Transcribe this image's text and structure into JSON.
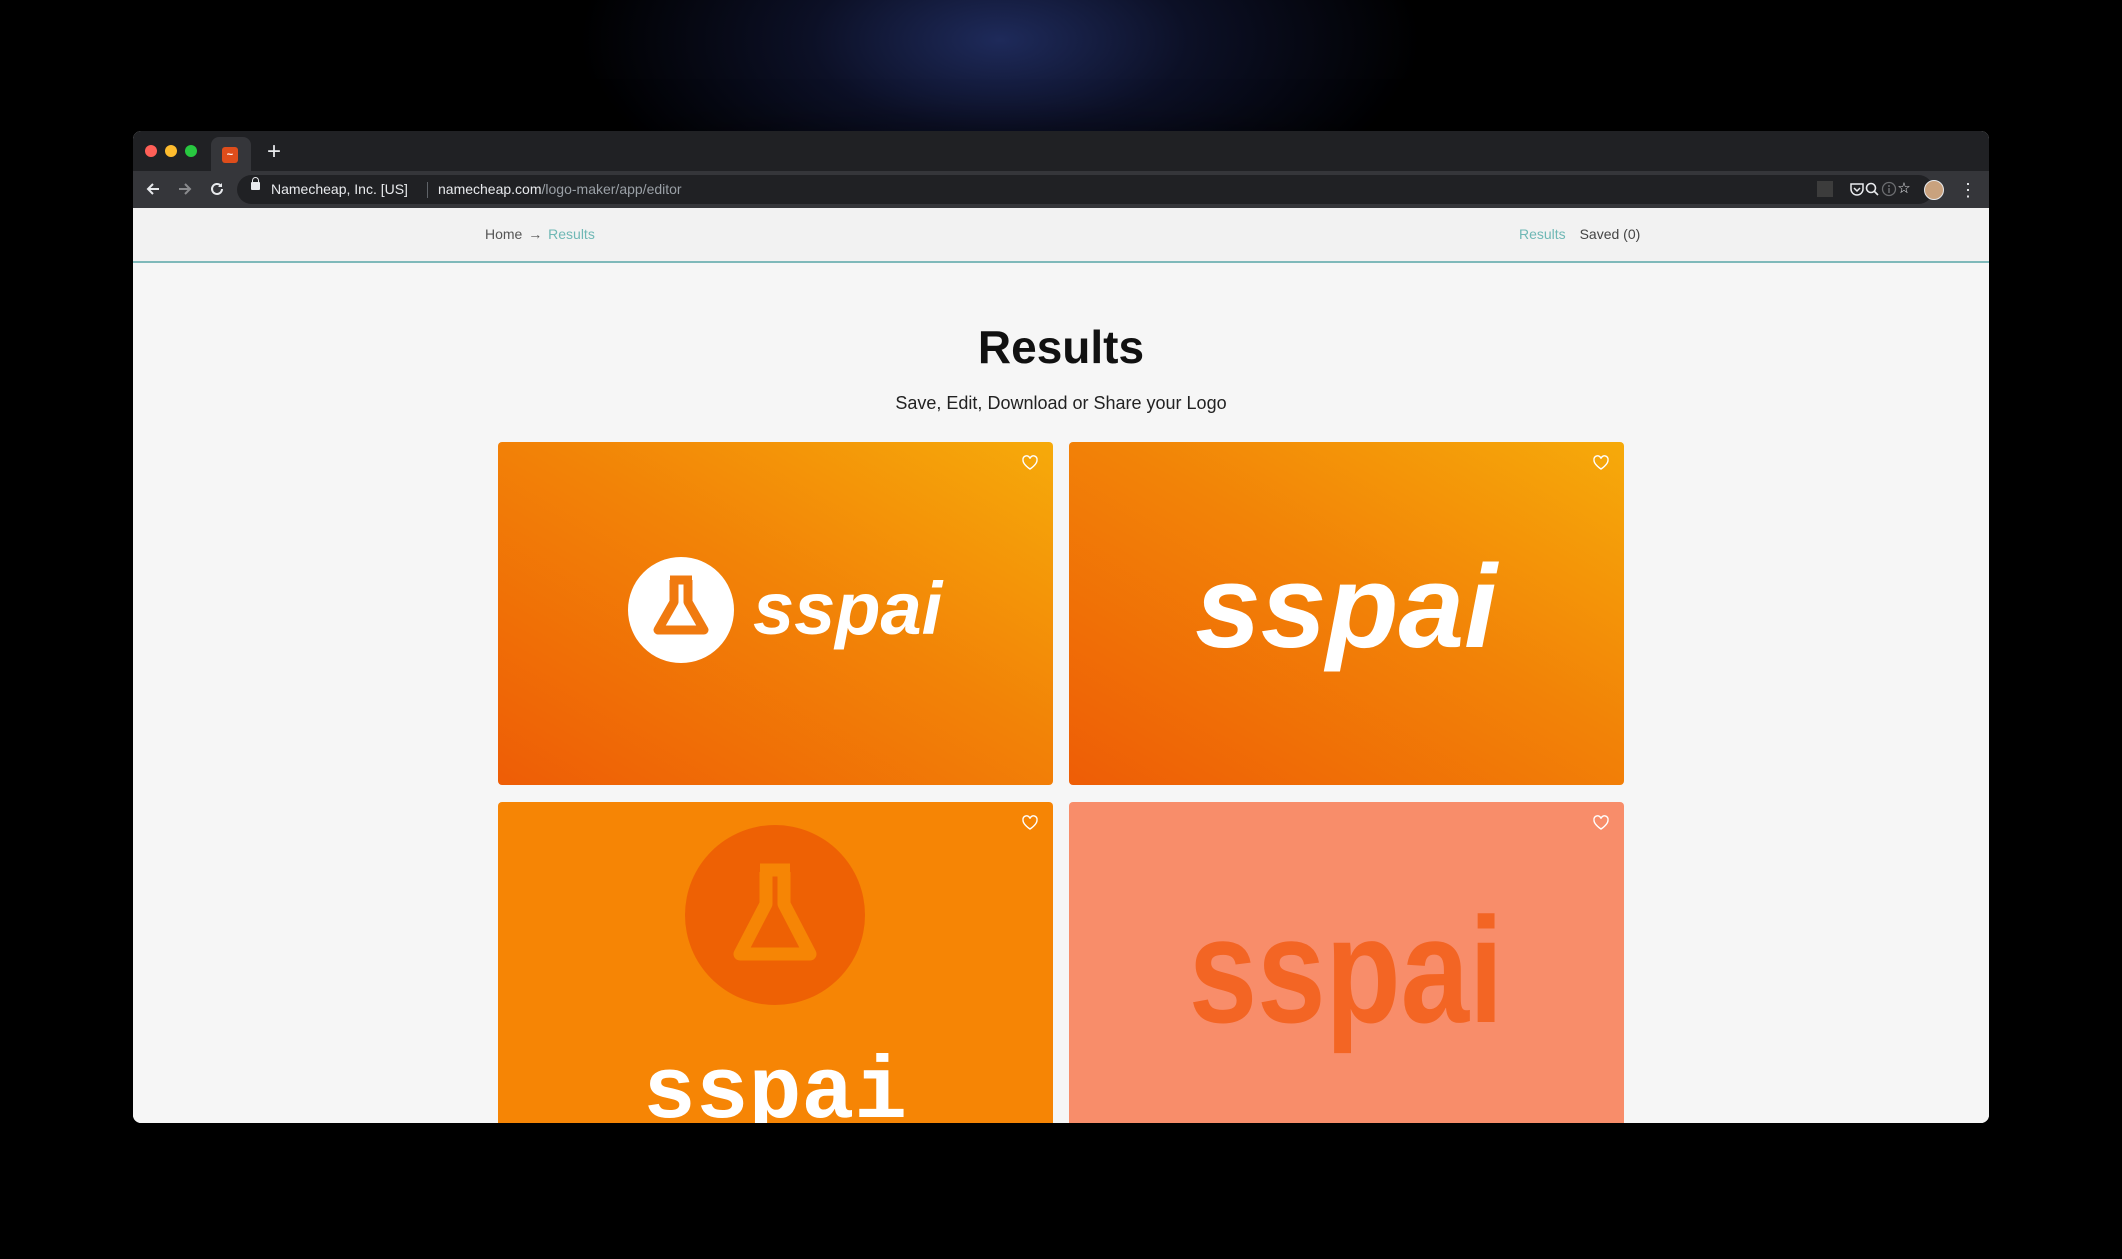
{
  "browser": {
    "tab_favicon_color": "#de4d1b",
    "site_identity": "Namecheap, Inc. [US]",
    "url_domain": "namecheap.com",
    "url_path": "/logo-maker/app/editor",
    "icons": [
      "back-arrow-icon",
      "forward-arrow-icon",
      "reload-icon",
      "lock-icon",
      "zoom-icon",
      "star-icon",
      "extension-icon",
      "pocket-icon",
      "info-icon",
      "profile-avatar",
      "kebab-menu-icon"
    ]
  },
  "subnav": {
    "home": "Home",
    "arrow": "→",
    "current": "Results",
    "results_link": "Results",
    "saved_link": "Saved (0)"
  },
  "main": {
    "title": "Results",
    "subtitle": "Save, Edit, Download or Share your Logo"
  },
  "logos": [
    {
      "wordmark": "sspai",
      "style": "icon-left white text",
      "background": "gradient orange"
    },
    {
      "wordmark": "sspai",
      "style": "bold italic white text",
      "background": "gradient orange"
    },
    {
      "wordmark": "sspai",
      "style": "icon-top white text",
      "background": "#f68505"
    },
    {
      "wordmark": "sspai",
      "style": "condensed orange text",
      "background": "#f88d6a"
    }
  ],
  "colors": {
    "accent": "#6fb8b5",
    "orange": "#f28307",
    "salmon": "#f88d6a",
    "deep_orange": "#ee5d06"
  }
}
